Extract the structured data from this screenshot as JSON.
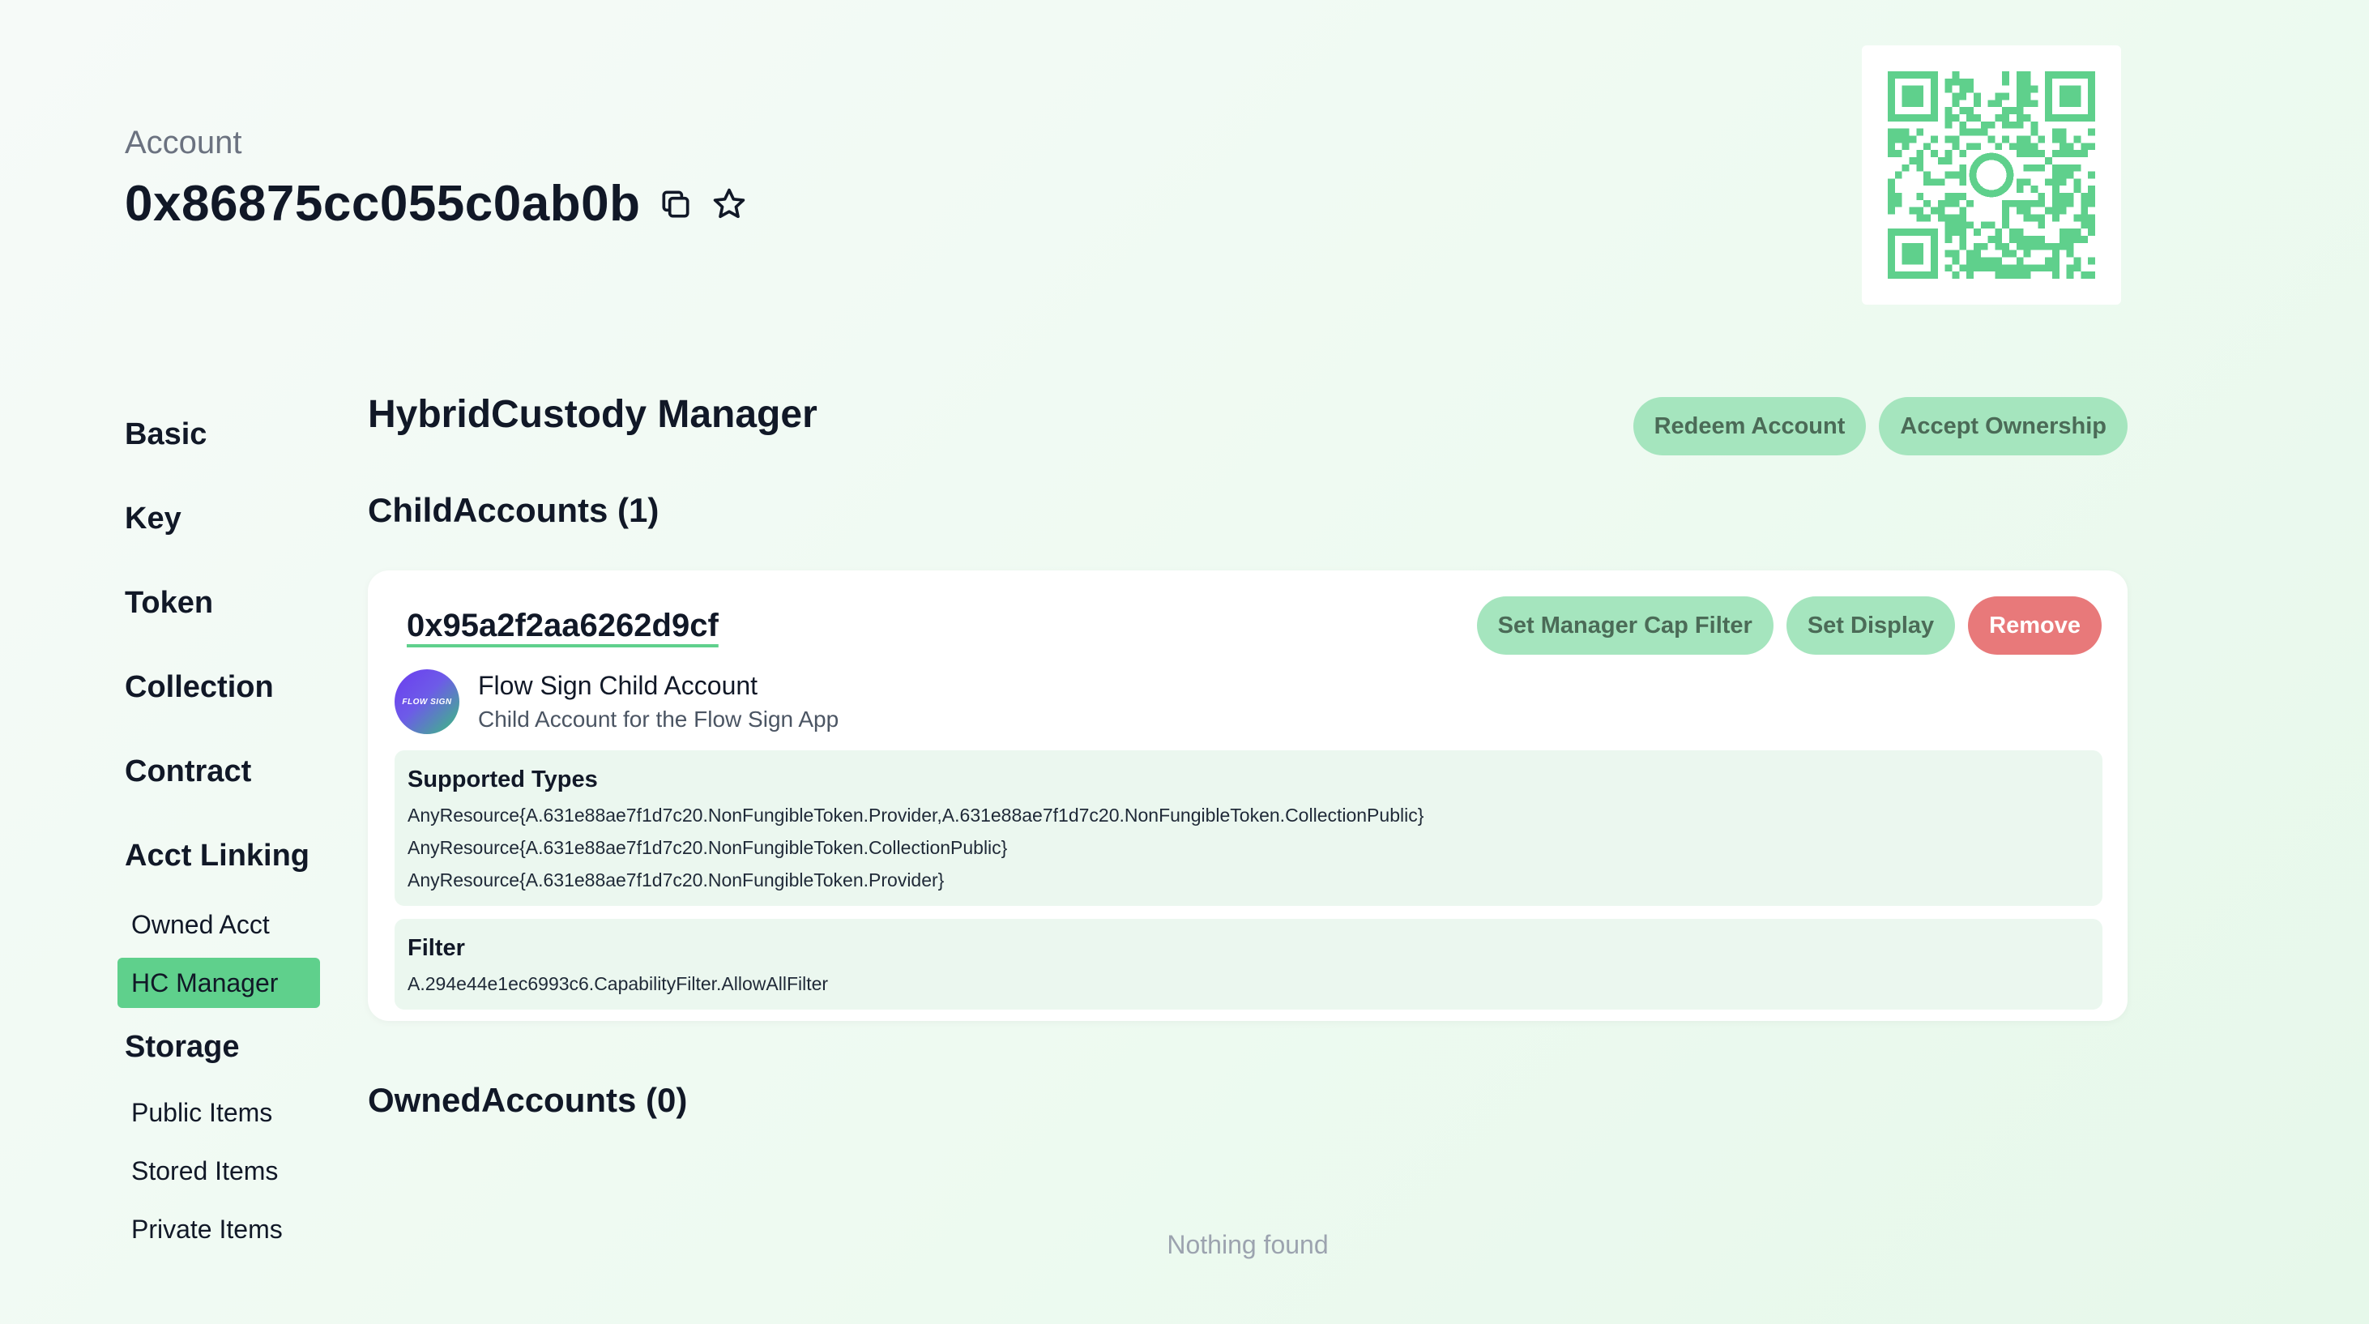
{
  "header": {
    "label": "Account",
    "address": "0x86875cc055c0ab0b",
    "copy_icon": "copy-icon",
    "favorite_icon": "star-icon"
  },
  "qr": {
    "icon": "qr-code",
    "color": "#5fd08c"
  },
  "sidebar": {
    "sections": [
      {
        "label": "Basic",
        "items": []
      },
      {
        "label": "Key",
        "items": []
      },
      {
        "label": "Token",
        "items": []
      },
      {
        "label": "Collection",
        "items": []
      },
      {
        "label": "Contract",
        "items": []
      },
      {
        "label": "Acct Linking",
        "items": [
          {
            "label": "Owned Acct",
            "active": false
          },
          {
            "label": "HC Manager",
            "active": true
          }
        ]
      },
      {
        "label": "Storage",
        "items": [
          {
            "label": "Public Items",
            "active": false
          },
          {
            "label": "Stored Items",
            "active": false
          },
          {
            "label": "Private Items",
            "active": false
          }
        ]
      }
    ]
  },
  "main": {
    "title": "HybridCustody Manager",
    "actions": {
      "redeem": "Redeem Account",
      "accept": "Accept Ownership"
    },
    "child_accounts": {
      "title": "ChildAccounts (1)",
      "items": [
        {
          "address": "0x95a2f2aa6262d9cf",
          "buttons": {
            "filter": "Set Manager Cap Filter",
            "display": "Set Display",
            "remove": "Remove"
          },
          "avatar_text": "FLOW SIGN",
          "name": "Flow Sign Child Account",
          "description": "Child Account for the Flow Sign App",
          "supported_types": {
            "title": "Supported Types",
            "lines": [
              "AnyResource{A.631e88ae7f1d7c20.NonFungibleToken.Provider,A.631e88ae7f1d7c20.NonFungibleToken.CollectionPublic}",
              "AnyResource{A.631e88ae7f1d7c20.NonFungibleToken.CollectionPublic}",
              "AnyResource{A.631e88ae7f1d7c20.NonFungibleToken.Provider}"
            ]
          },
          "filter": {
            "title": "Filter",
            "value": "A.294e44e1ec6993c6.CapabilityFilter.AllowAllFilter"
          }
        }
      ]
    },
    "owned_accounts": {
      "title": "OwnedAccounts (0)",
      "empty_text": "Nothing found"
    }
  },
  "colors": {
    "accent": "#5fd08c",
    "pill": "#a5e5be",
    "danger": "#e8797a"
  }
}
